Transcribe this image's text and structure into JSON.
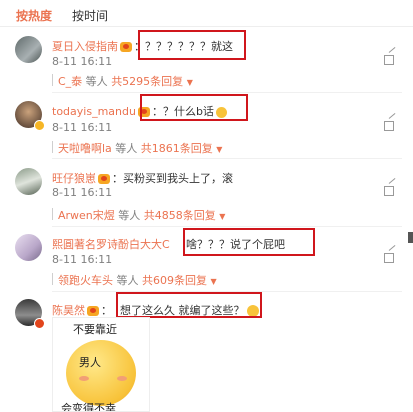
{
  "tabs": {
    "hot": "按热度",
    "time": "按时间"
  },
  "comments": [
    {
      "name": "夏日入侵指南",
      "sep": "：",
      "text": "？？？？？？就这",
      "time": "8-11 16:11",
      "reply_user": "C_泰",
      "reply_mid": " 等人 ",
      "reply_count": "共5295条回复"
    },
    {
      "name": "todayis_mandu",
      "sep": "：",
      "text": "？什么b话",
      "time": "8-11 16:11",
      "reply_user": "天啦噜啊la",
      "reply_mid": " 等人 ",
      "reply_count": "共1861条回复"
    },
    {
      "name": "旺仔狼崽",
      "sep": "：",
      "text": "买粉买到我头上了，滚",
      "time": "8-11 16:11",
      "reply_user": "Arwen宋煜",
      "reply_mid": " 等人 ",
      "reply_count": "共4858条回复"
    },
    {
      "name": "熙圓著名罗诗酚白大大C",
      "sep": "：",
      "text": "啥？？？说了个屁吧",
      "time": "8-11 16:11",
      "reply_user": "领跑火车头",
      "reply_mid": " 等人 ",
      "reply_count": "共609条回复"
    },
    {
      "name": "陈昊然",
      "sep": "：",
      "text": "想了这么久 就编了这些？",
      "time": "8-11 16:11"
    }
  ],
  "sticker": {
    "top": "不要靠近",
    "mid": "男人",
    "bottom": "会变得不幸"
  },
  "icons": {
    "share": "share-icon",
    "verified": "verified-badge-icon",
    "vip": "vip-crown-icon",
    "emoji": "grin-emoji-icon"
  },
  "colors": {
    "name": "#eb7350",
    "highlight": "#d0161c",
    "meta": "#808080"
  }
}
